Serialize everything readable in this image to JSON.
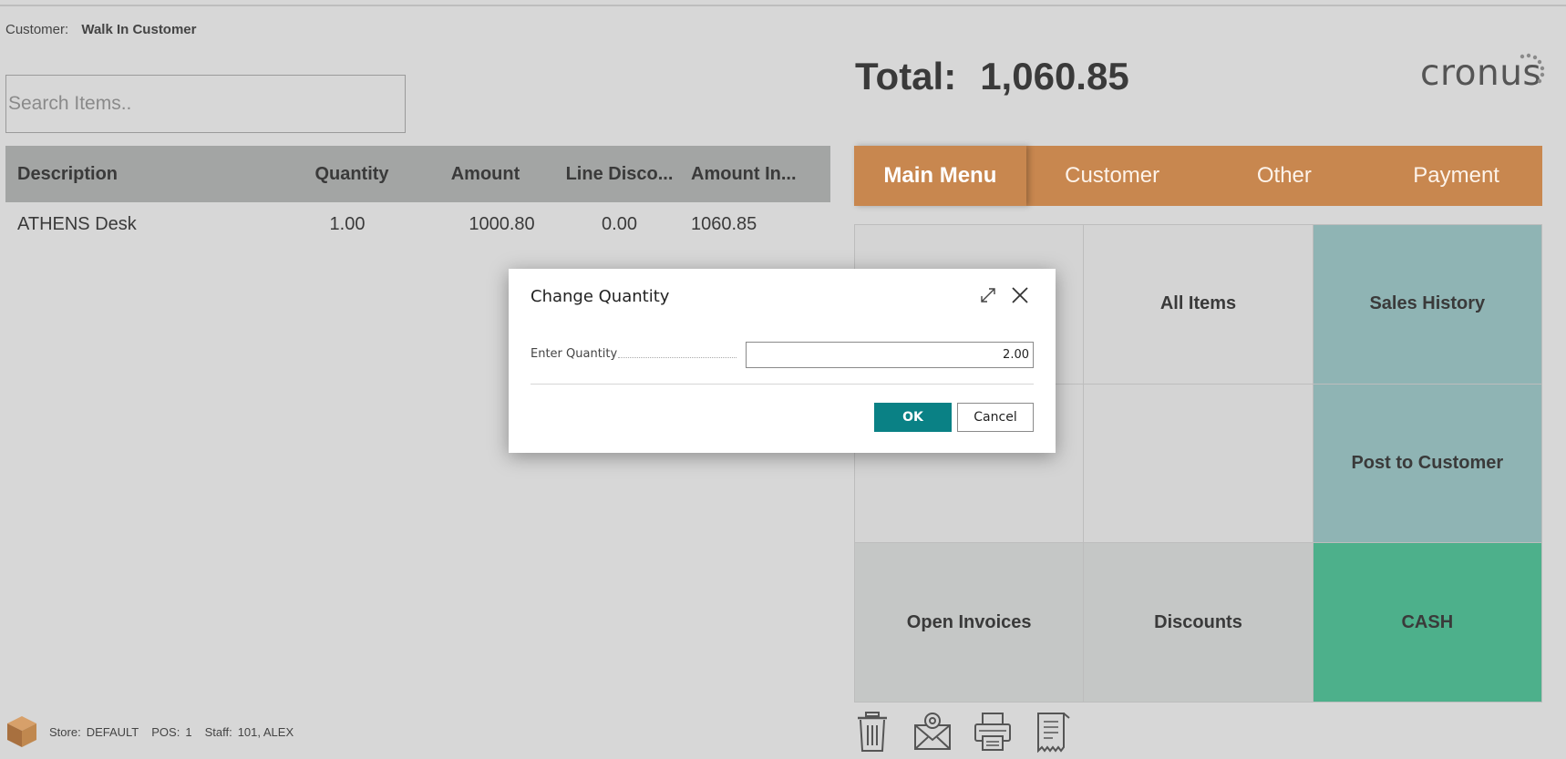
{
  "customer": {
    "label": "Customer:",
    "name": "Walk In Customer"
  },
  "search": {
    "placeholder": "Search Items.."
  },
  "table": {
    "headers": {
      "description": "Description",
      "quantity": "Quantity",
      "amount": "Amount",
      "line_discount": "Line Disco...",
      "amount_incl": "Amount In..."
    },
    "rows": [
      {
        "description": "ATHENS Desk",
        "quantity": "1.00",
        "amount": "1000.80",
        "line_discount": "0.00",
        "amount_incl": "1060.85"
      }
    ]
  },
  "total": {
    "label": "Total:",
    "value": "1,060.85"
  },
  "logo": {
    "text": "cronus"
  },
  "menu": {
    "tabs": [
      "Main Menu",
      "Customer",
      "Other",
      "Payment"
    ],
    "active": "Main Menu"
  },
  "tiles": [
    "",
    "All Items",
    "Sales History",
    "",
    "",
    "Post to Customer",
    "Open Invoices",
    "Discounts",
    "CASH"
  ],
  "status": {
    "store_label": "Store:",
    "store": "DEFAULT",
    "pos_label": "POS:",
    "pos": "1",
    "staff_label": "Staff:",
    "staff": "101, ALEX"
  },
  "dialog": {
    "title": "Change Quantity",
    "field_label": "Enter Quantity",
    "field_value": "2.00",
    "ok_label": "OK",
    "cancel_label": "Cancel"
  },
  "colors": {
    "menu_bar": "#c8874f",
    "tile_teal": "#8fb4b4",
    "tile_green": "#4db08b",
    "ok_button": "#0a8185"
  }
}
